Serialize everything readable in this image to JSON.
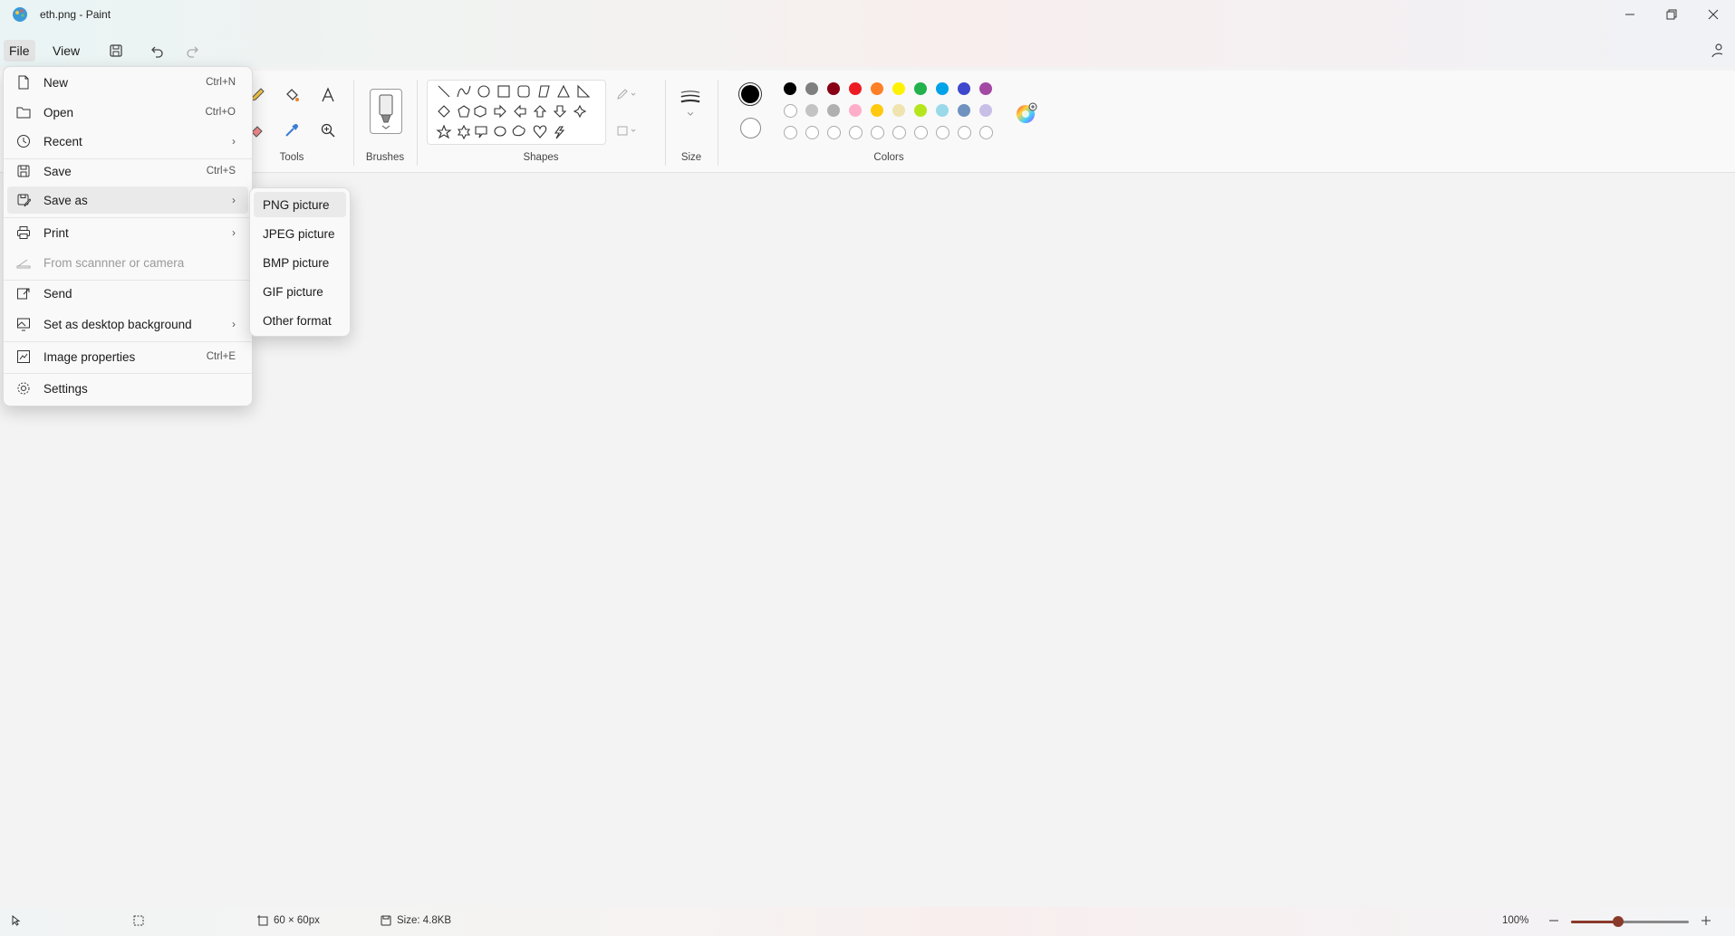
{
  "window": {
    "title": "eth.png - Paint",
    "minimize_icon": "minimize-icon",
    "restore_icon": "restore-icon",
    "close_icon": "close-icon"
  },
  "menubar": {
    "file_label": "File",
    "view_label": "View"
  },
  "ribbon": {
    "tools_label": "Tools",
    "brushes_label": "Brushes",
    "shapes_label": "Shapes",
    "size_label": "Size",
    "colors_label": "Colors"
  },
  "colors": {
    "primary": "#000000",
    "secondary": "#ffffff",
    "row1": [
      "#000000",
      "#7f7f7f",
      "#880015",
      "#ed1c24",
      "#ff7f27",
      "#fff200",
      "#22b14c",
      "#00a2e8",
      "#3f48cc",
      "#a349a4"
    ],
    "row2": [
      "#ffffff",
      "#c3c3c3",
      "#b0b0b0",
      "#ffaec9",
      "#ffc90e",
      "#efe4b0",
      "#b5e61d",
      "#99d9ea",
      "#7092be",
      "#c8bfe7"
    ]
  },
  "file_menu": {
    "items": [
      {
        "label": "New",
        "shortcut": "Ctrl+N",
        "icon": "new-file-icon"
      },
      {
        "label": "Open",
        "shortcut": "Ctrl+O",
        "icon": "folder-icon"
      },
      {
        "label": "Recent",
        "icon": "clock-icon"
      },
      {
        "label": "Save",
        "shortcut": "Ctrl+S",
        "icon": "save-icon"
      },
      {
        "label": "Save as",
        "icon": "save-as-icon"
      },
      {
        "label": "Print",
        "icon": "printer-icon"
      },
      {
        "label": "From scannner or camera",
        "icon": "scanner-icon",
        "disabled": true
      },
      {
        "label": "Send",
        "icon": "send-icon"
      },
      {
        "label": "Set as desktop background",
        "icon": "desktop-icon"
      },
      {
        "label": "Image properties",
        "shortcut": "Ctrl+E",
        "icon": "image-properties-icon"
      },
      {
        "label": "Settings",
        "icon": "gear-icon"
      }
    ]
  },
  "save_as_menu": {
    "items": [
      "PNG picture",
      "JPEG picture",
      "BMP picture",
      "GIF picture",
      "Other format"
    ]
  },
  "status": {
    "dimensions": "60 × 60px",
    "size": "Size: 4.8KB",
    "zoom": "100%",
    "zoom_fraction": 0.4
  }
}
